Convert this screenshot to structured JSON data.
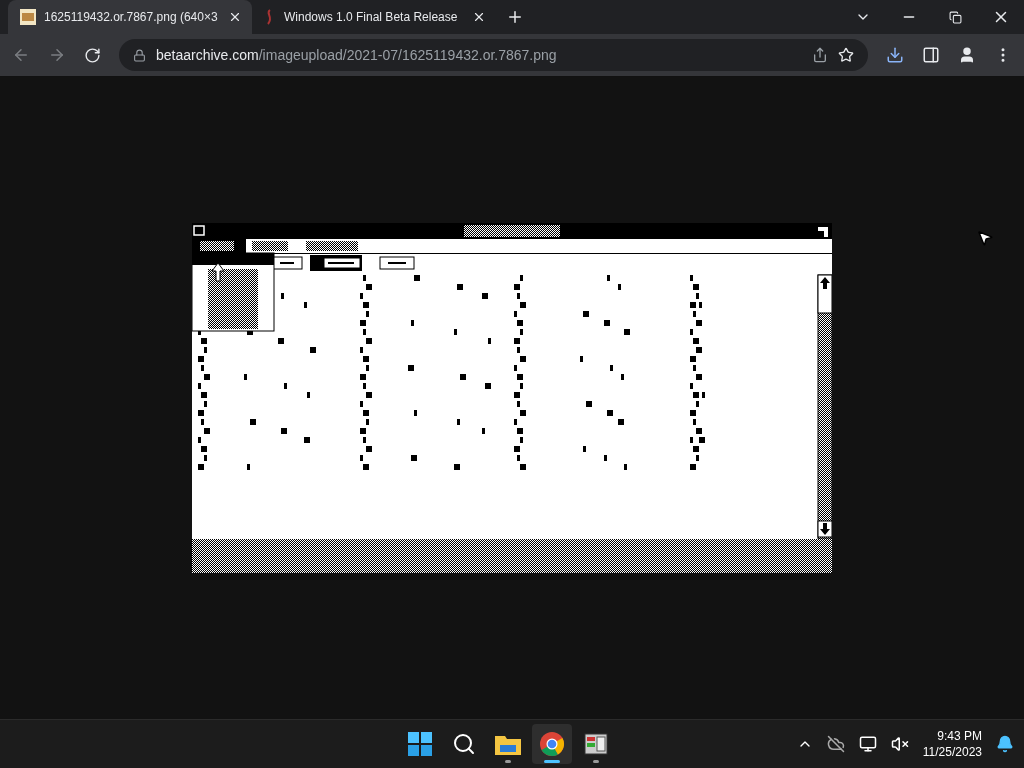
{
  "tabs": [
    {
      "title": "1625119432.or.7867.png (640×3",
      "selected": true,
      "kind": "image"
    },
    {
      "title": "Windows 1.0 Final Beta Release",
      "selected": false,
      "kind": "site"
    }
  ],
  "address": {
    "host": "betaarchive.com",
    "path": "/imageupload/2021-07/1625119432.or.7867.png"
  },
  "taskbar": [
    {
      "kind": "start",
      "running": false,
      "selected": false
    },
    {
      "kind": "search",
      "running": false,
      "selected": false
    },
    {
      "kind": "files",
      "running": true,
      "selected": false
    },
    {
      "kind": "browser",
      "running": true,
      "selected": true
    },
    {
      "kind": "app",
      "running": true,
      "selected": false
    }
  ],
  "clock": {
    "time": "9:43 PM",
    "date": "11/25/2023"
  }
}
